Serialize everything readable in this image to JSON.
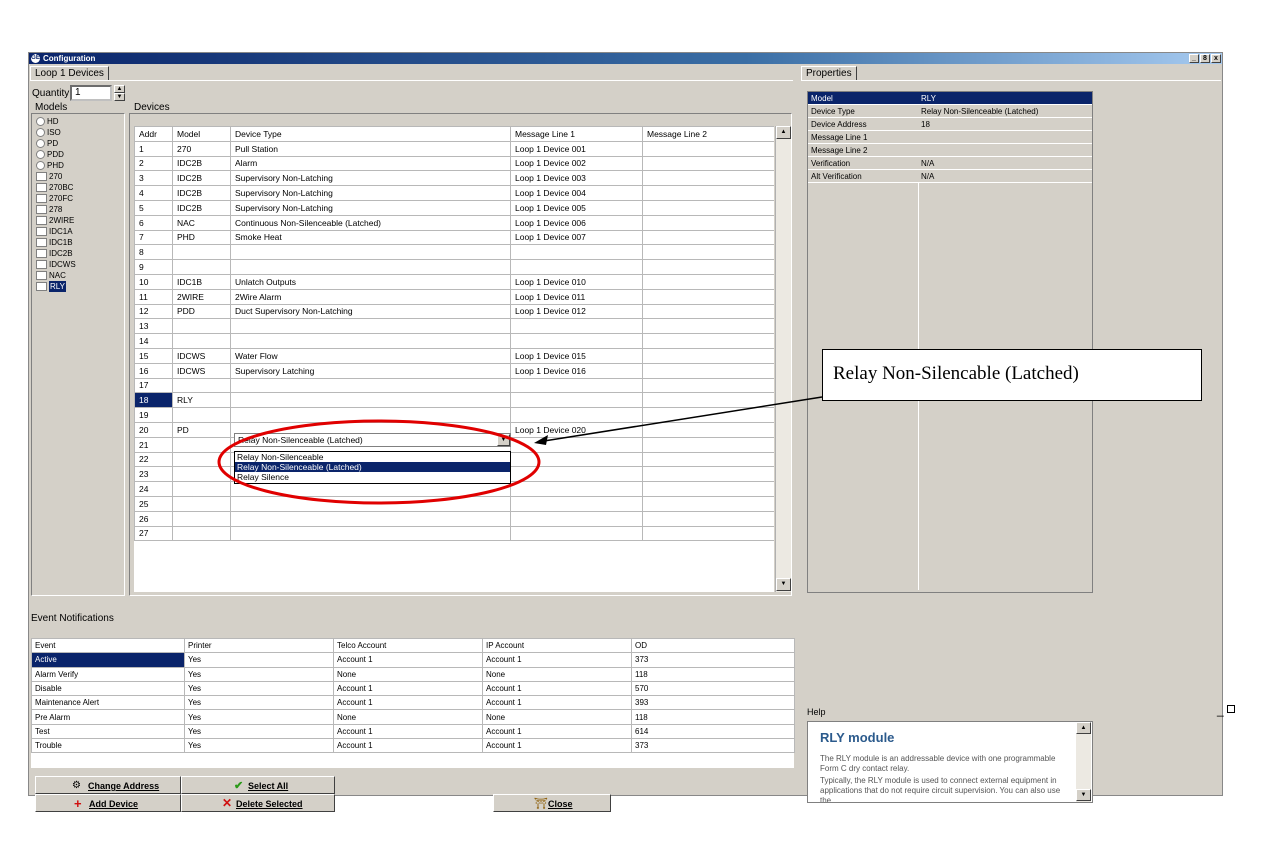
{
  "window": {
    "title": "Configuration",
    "controls": [
      "_",
      "8",
      "x"
    ]
  },
  "left_tab": "Loop 1 Devices",
  "right_tab": "Properties",
  "quantity": {
    "label": "Quantity:",
    "value": "1"
  },
  "models": {
    "title": "Models",
    "radio_items": [
      "HD",
      "ISO",
      "PD",
      "PDD",
      "PHD"
    ],
    "check_items": [
      "270",
      "270BC",
      "270FC",
      "278",
      "2WIRE",
      "IDC1A",
      "IDC1B",
      "IDC2B",
      "IDCWS",
      "NAC",
      "RLY"
    ]
  },
  "devices": {
    "title": "Devices",
    "columns": [
      "Addr",
      "Model",
      "Device Type",
      "Message Line 1",
      "Message Line 2"
    ],
    "rows": [
      [
        "1",
        "270",
        "Pull Station",
        "Loop 1 Device 001",
        ""
      ],
      [
        "2",
        "IDC2B",
        "Alarm",
        "Loop 1 Device 002",
        ""
      ],
      [
        "3",
        "IDC2B",
        "Supervisory Non-Latching",
        "Loop 1 Device 003",
        ""
      ],
      [
        "4",
        "IDC2B",
        "Supervisory Non-Latching",
        "Loop 1 Device 004",
        ""
      ],
      [
        "5",
        "IDC2B",
        "Supervisory Non-Latching",
        "Loop 1 Device 005",
        ""
      ],
      [
        "6",
        "NAC",
        "Continuous Non-Silenceable (Latched)",
        "Loop 1 Device 006",
        ""
      ],
      [
        "7",
        "PHD",
        "Smoke Heat",
        "Loop 1 Device 007",
        ""
      ],
      [
        "8",
        "",
        "",
        "",
        ""
      ],
      [
        "9",
        "",
        "",
        "",
        ""
      ],
      [
        "10",
        "IDC1B",
        "Unlatch Outputs",
        "Loop 1 Device 010",
        ""
      ],
      [
        "11",
        "2WIRE",
        "2Wire Alarm",
        "Loop 1 Device 011",
        ""
      ],
      [
        "12",
        "PDD",
        "Duct Supervisory Non-Latching",
        "Loop 1 Device 012",
        ""
      ],
      [
        "13",
        "",
        "",
        "",
        ""
      ],
      [
        "14",
        "",
        "",
        "",
        ""
      ],
      [
        "15",
        "IDCWS",
        "Water Flow",
        "Loop 1 Device 015",
        ""
      ],
      [
        "16",
        "IDCWS",
        "Supervisory Latching",
        "Loop 1 Device 016",
        ""
      ],
      [
        "17",
        "",
        "",
        "",
        ""
      ],
      [
        "18",
        "RLY",
        "",
        "",
        ""
      ],
      [
        "19",
        "",
        "",
        "",
        ""
      ],
      [
        "20",
        "PD",
        "",
        "Loop 1 Device 020",
        ""
      ],
      [
        "21",
        "",
        "",
        "",
        ""
      ],
      [
        "22",
        "",
        "",
        "",
        ""
      ],
      [
        "23",
        "",
        "",
        "",
        ""
      ],
      [
        "24",
        "",
        "",
        "",
        ""
      ],
      [
        "25",
        "",
        "",
        "",
        ""
      ],
      [
        "26",
        "",
        "",
        "",
        ""
      ],
      [
        "27",
        "",
        "",
        "",
        ""
      ]
    ],
    "dropdown": {
      "value": "Relay Non-Silenceable (Latched)",
      "options": [
        "Relay Non-Silenceable",
        "Relay Non-Silenceable (Latched)",
        "Relay Silence"
      ]
    }
  },
  "callout": "Relay Non-Silencable (Latched)",
  "events": {
    "title": "Event Notifications",
    "columns": [
      "Event",
      "Printer",
      "Telco Account",
      "IP Account",
      "OD"
    ],
    "rows": [
      [
        "Active",
        "Yes",
        "Account 1",
        "Account 1",
        "373"
      ],
      [
        "Alarm Verify",
        "Yes",
        "None",
        "None",
        "118"
      ],
      [
        "Disable",
        "Yes",
        "Account 1",
        "Account 1",
        "570"
      ],
      [
        "Maintenance Alert",
        "Yes",
        "Account 1",
        "Account 1",
        "393"
      ],
      [
        "Pre Alarm",
        "Yes",
        "None",
        "None",
        "118"
      ],
      [
        "Test",
        "Yes",
        "Account 1",
        "Account 1",
        "614"
      ],
      [
        "Trouble",
        "Yes",
        "Account 1",
        "Account 1",
        "373"
      ]
    ]
  },
  "buttons": {
    "change_address": "Change Address",
    "select_all": "Select All",
    "add_device": "Add Device",
    "delete_selected": "Delete Selected",
    "close": "Close"
  },
  "properties": {
    "rows": [
      [
        "Model",
        "RLY"
      ],
      [
        "Device Type",
        "Relay Non-Silenceable (Latched)"
      ],
      [
        "Device Address",
        "18"
      ],
      [
        "Message Line 1",
        ""
      ],
      [
        "Message Line 2",
        ""
      ],
      [
        "Verification",
        "N/A"
      ],
      [
        "Alt Verification",
        "N/A"
      ]
    ]
  },
  "help": {
    "label": "Help",
    "title": "RLY module",
    "para1": "The RLY module is an addressable device with one programmable Form C dry contact relay.",
    "para2": "Typically, the RLY module is used to connect external equipment in applications that do not require circuit supervision. You can also use the"
  },
  "colors": {
    "selection": "#0a246a",
    "window": "#d4d0c8",
    "annotation_ellipse": "#e00000"
  }
}
